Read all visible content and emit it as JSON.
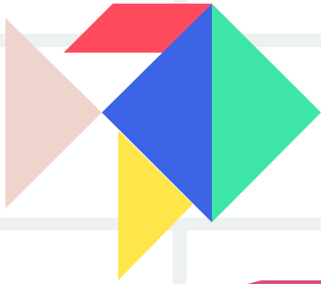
{
  "palette": {
    "background": "#ffffff",
    "grid": "#eef1f1",
    "pink_triangle": "#efd3cd",
    "red_parallelogram": "#fe4c5d",
    "blue_triangle": "#3d64e6",
    "green_triangle": "#3de5a6",
    "yellow_triangle": "#fee549",
    "magenta_corner": "#d84f7d"
  },
  "pieces": [
    "pink-triangle",
    "red-parallelogram",
    "blue-triangle",
    "green-triangle",
    "yellow-triangle",
    "magenta-corner-shape"
  ]
}
